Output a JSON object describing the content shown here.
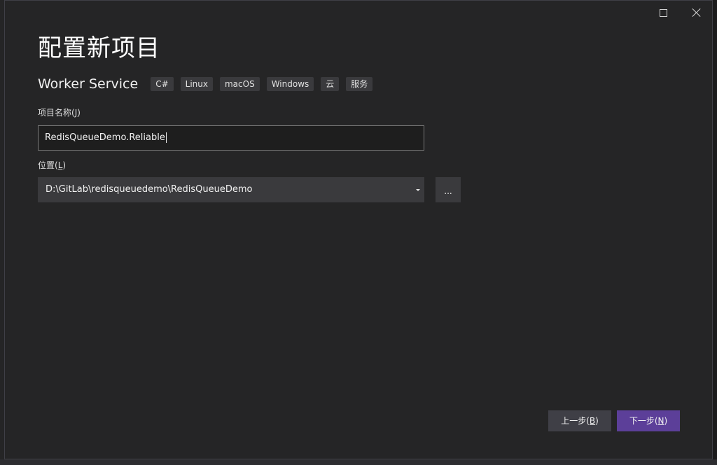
{
  "dialog": {
    "title": "配置新项目"
  },
  "template": {
    "name": "Worker Service",
    "tags": [
      "C#",
      "Linux",
      "macOS",
      "Windows",
      "云",
      "服务"
    ]
  },
  "project_name": {
    "label": "项目名称",
    "label_key_prefix": "(",
    "label_key": "J",
    "label_key_suffix": ")",
    "value": "RedisQueueDemo.Reliable"
  },
  "location": {
    "label": "位置",
    "label_key_prefix": "(",
    "label_key": "L",
    "label_key_suffix": ")",
    "value": "D:\\GitLab\\redisqueuedemo\\RedisQueueDemo",
    "browse_label": "..."
  },
  "buttons": {
    "back_label": "上一步",
    "back_key": "B",
    "next_label": "下一步",
    "next_key": "N"
  },
  "colors": {
    "dialog_bg": "#252526",
    "accent": "#5c3f99",
    "input_border": "#7a7a7a"
  }
}
